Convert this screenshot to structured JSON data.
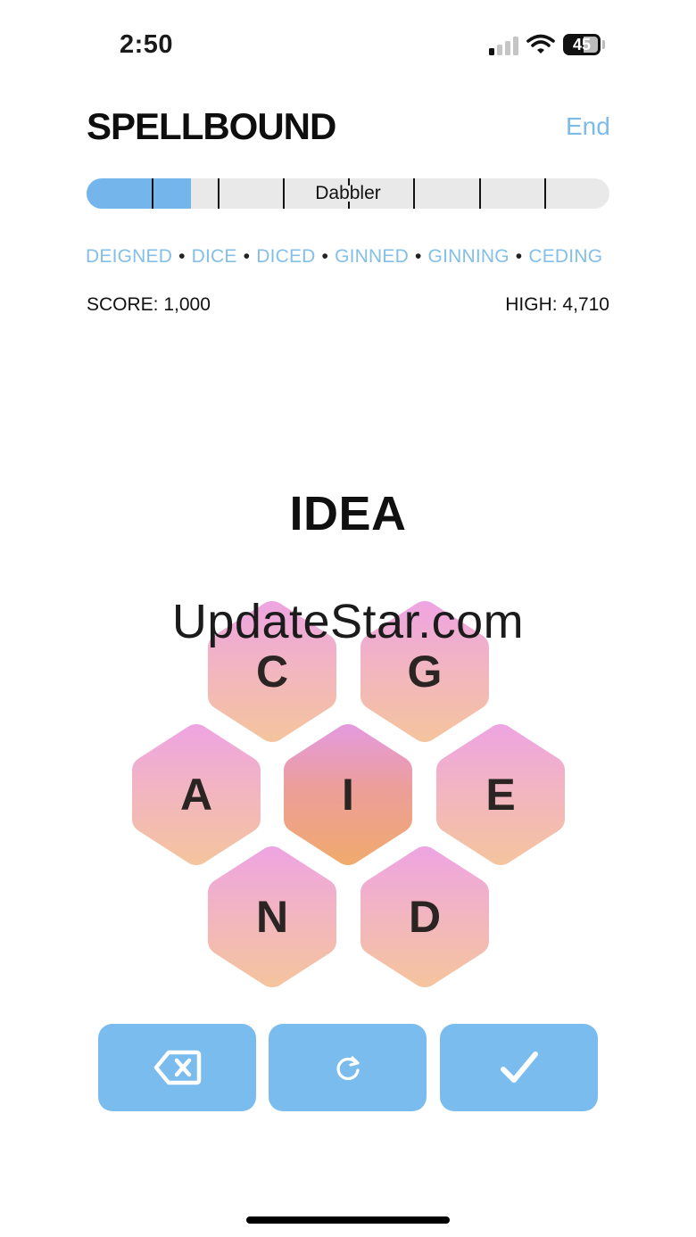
{
  "status": {
    "time": "2:50",
    "battery": "45"
  },
  "header": {
    "title": "SPELLBOUND",
    "end_label": "End"
  },
  "progress": {
    "rank": "Dabbler",
    "fill_fraction": 0.2
  },
  "found_words": [
    "DEIGNED",
    "DICE",
    "DICED",
    "GINNED",
    "GINNING",
    "CEDING"
  ],
  "score": {
    "label": "SCORE: 1,000",
    "high_label": "HIGH: 4,710"
  },
  "current_word": "IDEA",
  "letters": {
    "top_left": "C",
    "top_right": "G",
    "left": "A",
    "center": "I",
    "right": "E",
    "bottom_left": "N",
    "bottom_right": "D"
  },
  "watermark": "UpdateStar.com",
  "actions": {
    "delete_icon": "backspace-icon",
    "shuffle_icon": "shuffle-icon",
    "submit_icon": "check-icon"
  },
  "colors": {
    "accent": "#7bbcee",
    "link": "#84bfe8",
    "hex_top": "#eea4e2",
    "hex_bottom": "#f3c29f",
    "center_top": "#e79de0",
    "center_bottom": "#f0a86a"
  }
}
